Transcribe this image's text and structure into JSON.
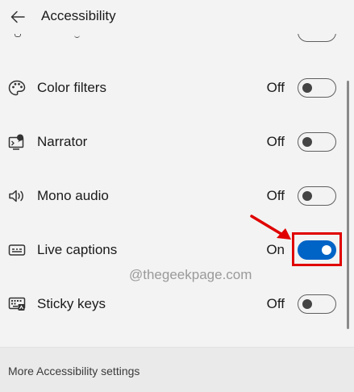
{
  "header": {
    "title": "Accessibility",
    "back_icon": "arrow-left-icon"
  },
  "settings": [
    {
      "label": "Color filters",
      "state": "Off",
      "on": false,
      "icon": "palette-icon"
    },
    {
      "label": "Narrator",
      "state": "Off",
      "on": false,
      "icon": "narrator-icon"
    },
    {
      "label": "Mono audio",
      "state": "Off",
      "on": false,
      "icon": "speaker-icon"
    },
    {
      "label": "Live captions",
      "state": "On",
      "on": true,
      "icon": "captions-icon"
    },
    {
      "label": "Sticky keys",
      "state": "Off",
      "on": false,
      "icon": "keyboard-icon"
    }
  ],
  "watermark": "@thegeekpage.com",
  "footer": {
    "link_label": "More Accessibility settings"
  },
  "colors": {
    "accent": "#0063c6",
    "highlight": "#e00000",
    "background": "#f3f3f3"
  }
}
